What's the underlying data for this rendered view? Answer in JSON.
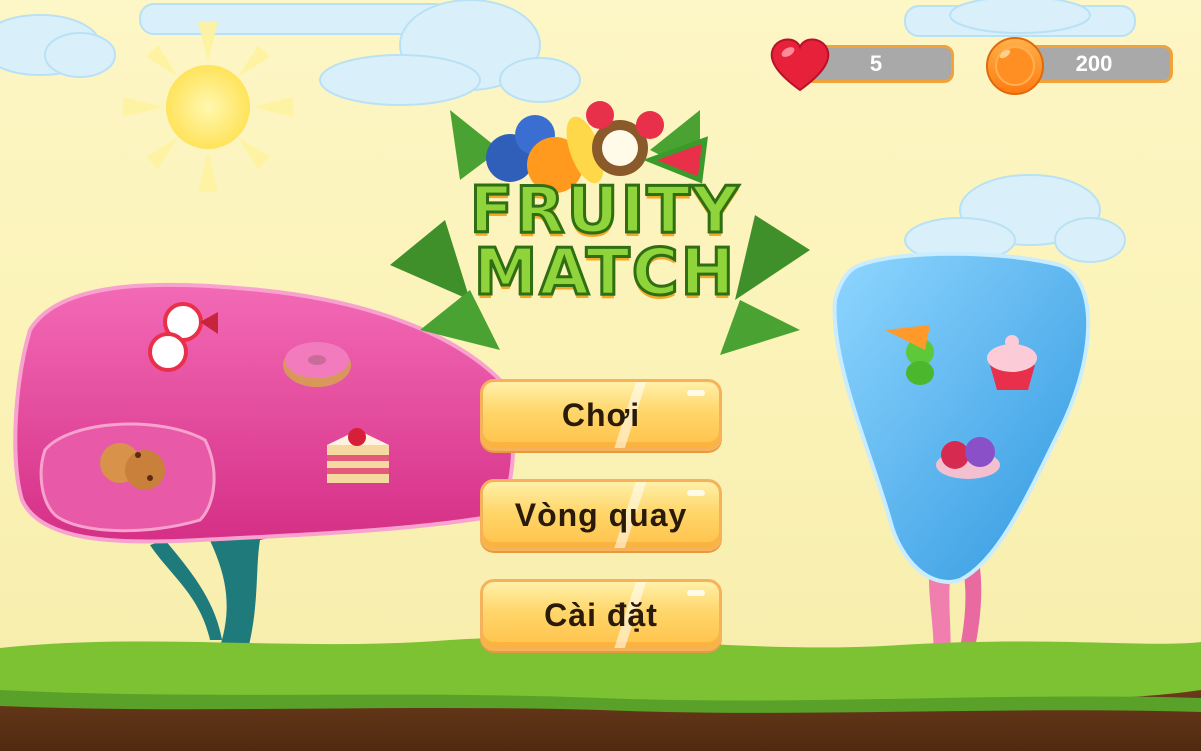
{
  "hud": {
    "lives": {
      "icon": "heart-icon",
      "value": "5"
    },
    "coins": {
      "icon": "coin-icon",
      "value": "200"
    }
  },
  "logo": {
    "line1": "FRUITY",
    "line2": "MATCH"
  },
  "menu": {
    "play_label": "Chơi",
    "spin_label": "Vòng quay",
    "settings_label": "Cài đặt"
  },
  "colors": {
    "sky": "#fbf3b8",
    "button": "#ffd66a",
    "button_border": "#f6b25a",
    "hud_bar": "#a9a9a9",
    "ground": "#6b3a17",
    "grass": "#7cc233",
    "pink_tree": "#e8439a",
    "blue_tree": "#58b6ee"
  }
}
